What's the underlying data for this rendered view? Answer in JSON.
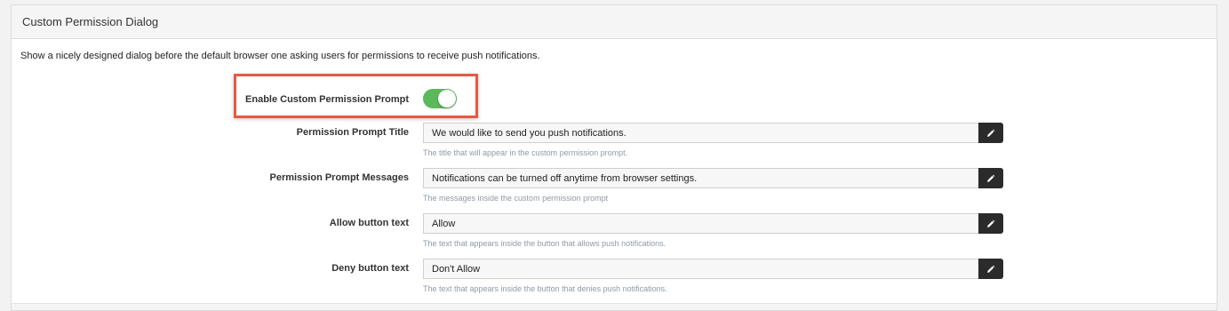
{
  "panel": {
    "title": "Custom Permission Dialog",
    "description": "Show a nicely designed dialog before the default browser one asking users for permissions to receive push notifications."
  },
  "toggle_row": {
    "label": "Enable Custom Permission Prompt",
    "enabled": true,
    "on_color": "#5cb85c",
    "highlight_color": "#e25b45"
  },
  "fields": [
    {
      "label": "Permission Prompt Title",
      "value": "We would like to send you push notifications.",
      "help": "The title that will appear in the custom permission prompt.",
      "edit_icon": "pencil-icon"
    },
    {
      "label": "Permission Prompt Messages",
      "value": "Notifications can be turned off anytime from browser settings.",
      "help": "The messages inside the custom permission prompt",
      "edit_icon": "pencil-icon"
    },
    {
      "label": "Allow button text",
      "value": "Allow",
      "help": "The text that appears inside the button that allows push notifications.",
      "edit_icon": "pencil-icon"
    },
    {
      "label": "Deny button text",
      "value": "Don't Allow",
      "help": "The text that appears inside the button that denies push notifications.",
      "edit_icon": "pencil-icon"
    }
  ]
}
